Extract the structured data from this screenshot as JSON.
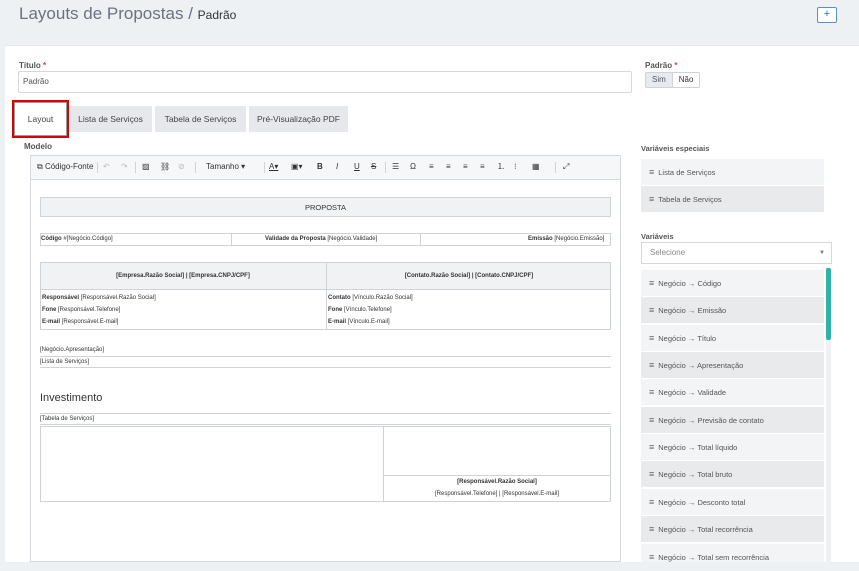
{
  "header": {
    "title": "Layouts de Propostas",
    "separator": "/",
    "subtitle": "Padrão",
    "plus": "+"
  },
  "form": {
    "titulo_label": "Título",
    "titulo_value": "Padrão",
    "padrao_label": "Padrão",
    "sim": "Sim",
    "nao": "Não",
    "required": "*"
  },
  "tabs": [
    "Layout",
    "Lista de Serviços",
    "Tabela de Serviços",
    "Pré-Visualização PDF"
  ],
  "editor": {
    "label": "Modelo",
    "toolbar": {
      "source": "Código-Fonte",
      "size": "Tamanho",
      "bold": "B",
      "italic": "I",
      "underline": "U",
      "strike": "S",
      "omega": "Ω"
    },
    "doc": {
      "heading": "PROPOSTA",
      "code_label": "Código",
      "code_value": "#[Negócio.Código]",
      "valid_label": "Validade da Proposta",
      "valid_value": "[Negócio.Validade]",
      "emission_label": "Emissão",
      "emission_value": "[Negócio.Emissão]",
      "company_header": "[Empresa.Razão Social] | [Empresa.CNPJ/CPF]",
      "contact_header": "[Contato.Razão Social] | [Contato.CNPJ/CPF]",
      "resp_label": "Responsável",
      "resp_value": "[Responsável.Razão Social]",
      "fone_label": "Fone",
      "fone_value": "[Responsável.Telefone]",
      "email_label": "E-mail",
      "email_value": "[Responsável.E-mail]",
      "contato_label": "Contato",
      "contato_value": "[Vínculo.Razão Social]",
      "fone2_label": "Fone",
      "fone2_value": "[Vínculo.Telefone]",
      "email2_label": "E-mail",
      "email2_value": "[Vínculo.E-mail]",
      "apresentacao": "[Negócio.Apresentação]",
      "lista": "[Lista de Serviços]",
      "investimento": "Investimento",
      "tabela": "[Tabela de Serviços]",
      "sign_name": "[Responsável.Razão Social]",
      "sign_contacts": "[Responsável.Telefone] | [Responsável.E-mail]"
    }
  },
  "sidebar": {
    "special_label": "Variáveis especiais",
    "special_items": [
      "Lista de Serviços",
      "Tabela de Serviços"
    ],
    "vars_label": "Variáveis",
    "select_placeholder": "Selecione",
    "items": [
      "Negócio → Código",
      "Negócio → Emissão",
      "Negócio → Título",
      "Negócio → Apresentação",
      "Negócio → Validade",
      "Negócio → Previsão de contato",
      "Negócio → Total líquido",
      "Negócio → Total bruto",
      "Negócio → Desconto total",
      "Negócio → Total recorrência",
      "Negócio → Total sem recorrência"
    ]
  }
}
